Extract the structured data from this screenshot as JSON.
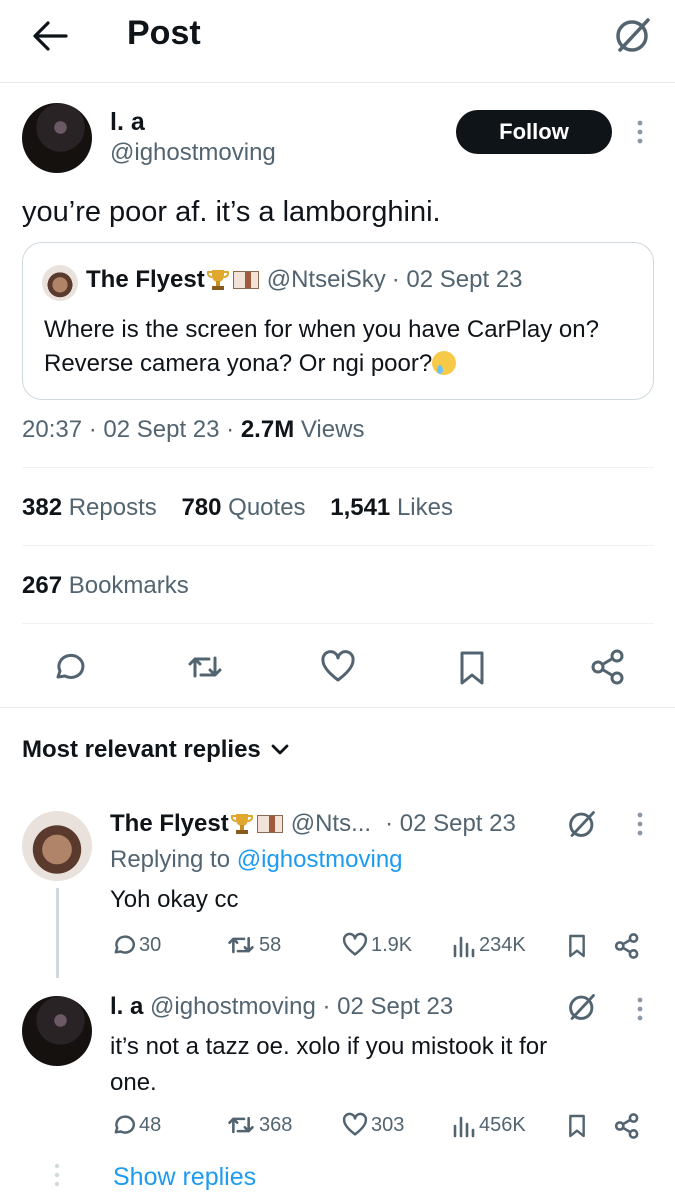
{
  "header": {
    "title": "Post",
    "back_icon": "arrow-left-icon",
    "grok_icon": "grok-icon"
  },
  "post": {
    "author_name": "l. a",
    "author_handle": "@ighostmoving",
    "follow_label": "Follow",
    "text": "you’re poor af. it’s a lamborghini.",
    "quote": {
      "author_name": "The Flyest",
      "author_handle": "@NtseiSky",
      "date": "· 02 Sept 23",
      "text": "Where is the screen for when you have CarPlay on? Reverse camera yona? Or ngi poor?"
    },
    "time": "20:37",
    "date": "· 02 Sept 23 ·",
    "views_count": "2.7M",
    "views_label": "Views",
    "reposts_count": "382",
    "reposts_label": "Reposts",
    "quotes_count": "780",
    "quotes_label": "Quotes",
    "likes_count": "1,541",
    "likes_label": "Likes",
    "bookmarks_count": "267",
    "bookmarks_label": "Bookmarks"
  },
  "replies_sort": {
    "label": "Most relevant replies"
  },
  "replies": [
    {
      "author_name": "The Flyest",
      "author_handle": "@Nts...",
      "date": "· 02 Sept 23",
      "replying_prefix": "Replying to",
      "replying_handle": "@ighostmoving",
      "text": "Yoh okay cc",
      "replies": "30",
      "reposts": "58",
      "likes": "1.9K",
      "views": "234K"
    },
    {
      "author_name": "l. a",
      "author_handle": "@ighostmoving",
      "date": "· 02 Sept 23",
      "text_line1": "it’s not a tazz oe. xolo if you mistook it for",
      "text_line2": "one.",
      "replies": "48",
      "reposts": "368",
      "likes": "303",
      "views": "456K"
    }
  ],
  "show_replies_label": "Show replies",
  "colors": {
    "text": "#0f1419",
    "muted": "#536471",
    "link": "#1d9bf0",
    "border": "#cfd9de"
  }
}
